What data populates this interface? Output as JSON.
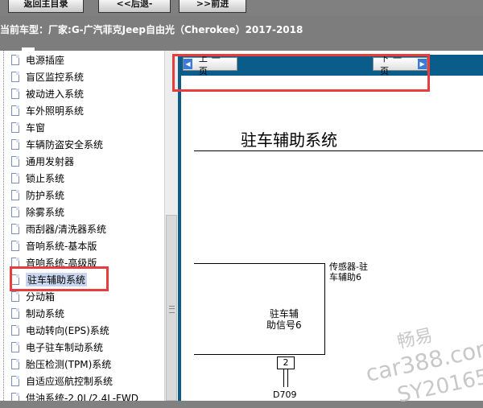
{
  "top_nav": {
    "back_to_home": "返回主目录",
    "previous": "<<后退-",
    "next": ">>前进"
  },
  "vehicle_info": {
    "label": "当前车型：",
    "value": "厂家:G-广汽菲克Jeep自由光（Cherokee）2017-2018"
  },
  "tree": {
    "items": [
      {
        "label": "电源插座"
      },
      {
        "label": "盲区监控系统"
      },
      {
        "label": "被动进入系统"
      },
      {
        "label": "车外照明系统"
      },
      {
        "label": "车窗"
      },
      {
        "label": "车辆防盗安全系统"
      },
      {
        "label": "通用发射器"
      },
      {
        "label": "锁止系统"
      },
      {
        "label": "防护系统"
      },
      {
        "label": "除雾系统"
      },
      {
        "label": "雨刮器/清洗器系统"
      },
      {
        "label": "音响系统-基本版"
      },
      {
        "label": "音响系统-高级版"
      },
      {
        "label": "驻车辅助系统",
        "selected": true
      },
      {
        "label": "分动箱"
      },
      {
        "label": "制动系统"
      },
      {
        "label": "电动转向(EPS)系统"
      },
      {
        "label": "电子驻车制动系统"
      },
      {
        "label": "胎压检测(TPM)系统"
      },
      {
        "label": "自适应巡航控制系统"
      },
      {
        "label": "供油系统-2.0L/2.4L-FWD"
      }
    ]
  },
  "content": {
    "prev_page": "上一页",
    "next_page": "下一页",
    "title": "驻车辅助系统",
    "component_label_line1": "驻车辅",
    "component_label_line2": "助信号6",
    "sensor_label_line1": "传感器-驻",
    "sensor_label_line2": "车辅助6",
    "pin_number": "2",
    "connector": "D709"
  },
  "watermark": {
    "line1": "畅易",
    "line2": "car388.com",
    "line3": "SY20165"
  }
}
